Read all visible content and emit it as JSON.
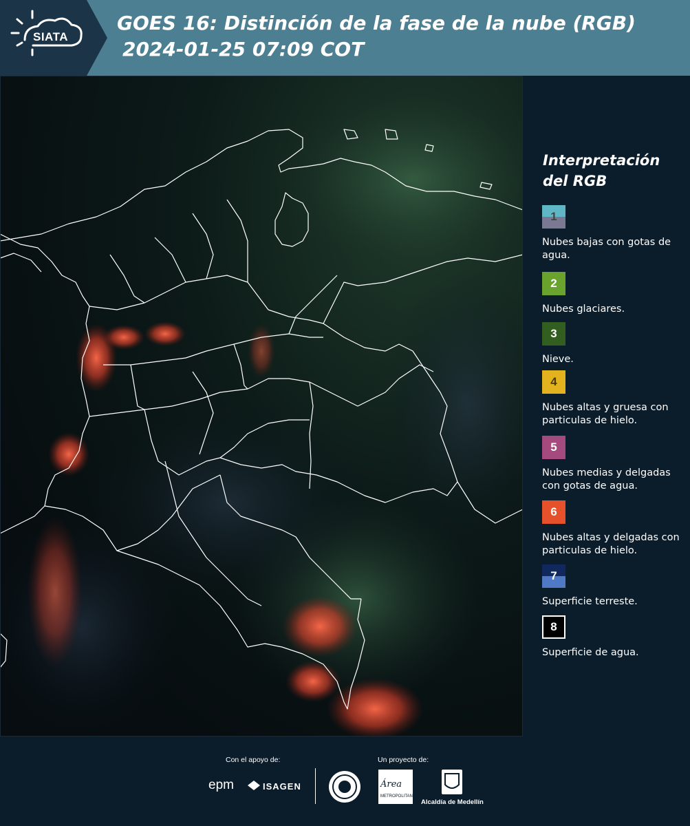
{
  "header": {
    "logo_text": "SIATA",
    "title": "GOES 16: Distinción de la fase de la nube (RGB)",
    "subtitle": "2024-01-25 07:09 COT"
  },
  "legend": {
    "title": "Interpretación del RGB",
    "items": [
      {
        "num": "1",
        "label": "Nubes bajas con gotas de agua.",
        "colors": [
          "#5fb7c6",
          "#7a7892"
        ]
      },
      {
        "num": "2",
        "label": "Nubes glaciares.",
        "color": "#6aa22e"
      },
      {
        "num": "3",
        "label": "Nieve.",
        "color": "#325f1f"
      },
      {
        "num": "4",
        "label": "Nubes altas y gruesa con particulas de hielo.",
        "color": "#e2b21f"
      },
      {
        "num": "5",
        "label": "Nubes medias y delgadas con gotas de agua.",
        "color": "#a44a7e"
      },
      {
        "num": "6",
        "label": "Nubes altas y delgadas con particulas de hielo.",
        "color": "#e5512a"
      },
      {
        "num": "7",
        "label": "Superficie terreste.",
        "colors": [
          "#10285e",
          "#4f79c5"
        ]
      },
      {
        "num": "8",
        "label": "Superficie de agua.",
        "color": "#000000"
      }
    ]
  },
  "footer": {
    "support_label": "Con el apoyo de:",
    "project_label": "Un proyecto de:",
    "epm_text": "epm",
    "isagen_text": "ISAGEN",
    "area_text": "Área",
    "area_sub": "METROPOLITANA",
    "alcaldia_text": "Alcaldía de Medellín"
  }
}
